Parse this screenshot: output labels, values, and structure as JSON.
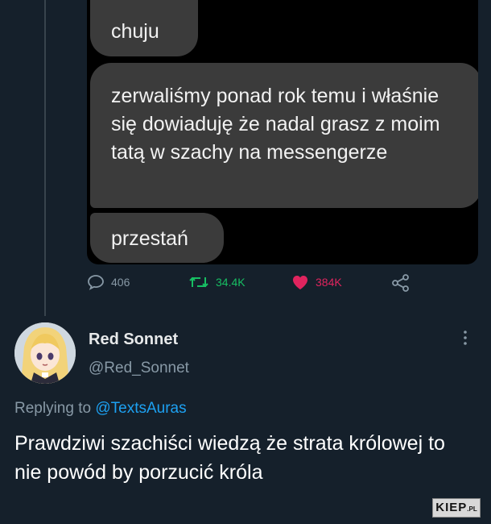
{
  "chat": {
    "messages": [
      "chuju",
      "zerwaliśmy ponad rok temu i właśnie się dowiaduję że nadal grasz z moim tatą w szachy na messengerze",
      "przestań"
    ]
  },
  "actions": {
    "replies": "406",
    "retweets": "34.4K",
    "likes": "384K",
    "retweet_color": "#17bf63",
    "like_color": "#e0245e"
  },
  "reply": {
    "author_name": "Red Sonnet",
    "author_handle": "@Red_Sonnet",
    "replying_label": "Replying to",
    "replying_to": "@TextsAuras",
    "text": "Prawdziwi szachiści wiedzą że strata królowej to nie powód by porzucić króla",
    "mention_color": "#1da1f2"
  },
  "watermark": {
    "text": "KIEP",
    "suffix": ".PL"
  },
  "colors": {
    "background": "#15202b",
    "bubble": "#3b3b3b"
  }
}
